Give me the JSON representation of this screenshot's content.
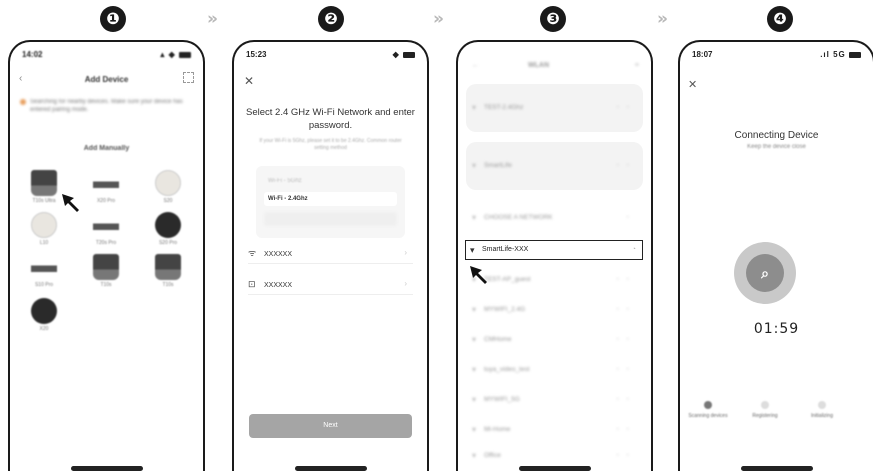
{
  "steps": [
    "❶",
    "❷",
    "❸",
    "❹"
  ],
  "separator": "»",
  "phone1": {
    "time": "14:02",
    "title": "Add Device",
    "notice": "Searching for nearby devices. Make sure your device has entered pairing mode.",
    "section": "Add Manually",
    "devices": [
      {
        "label": "T10s Ultra"
      },
      {
        "label": "X20 Pro"
      },
      {
        "label": "S20"
      },
      {
        "label": "L10"
      },
      {
        "label": "T20s Pro"
      },
      {
        "label": "S20 Pro"
      },
      {
        "label": "S10 Pro"
      },
      {
        "label": "T10s"
      },
      {
        "label": "T10s"
      },
      {
        "label": "X20"
      }
    ]
  },
  "phone2": {
    "time": "15:23",
    "title": "Select 2.4 GHz Wi-Fi Network and enter password.",
    "hint": "If your Wi-Fi is 5Ghz, please set it to be 2.4Ghz. Common router setting method",
    "wifi_rows": [
      "Wi-Fi - 5Ghz",
      "Wi-Fi - 2.4Ghz"
    ],
    "ssid": "XXXXXX",
    "password": "XXXXXX",
    "next_label": "Next"
  },
  "phone3": {
    "title": "WLAN",
    "networks_top": [
      "TEST-2.4Ghz",
      "SmartLife"
    ],
    "other_label": "CHOOSE A NETWORK",
    "selected_network": "SmartLife-XXX",
    "networks": [
      "TEST-AP_guest",
      "MYWIFI_2.4G",
      "CMHome",
      "tuya_video_test",
      "MYWIFI_5G",
      "Mi-Home",
      "Office"
    ]
  },
  "phone4": {
    "time": "18:07",
    "title": "Connecting Device",
    "subtitle": "Keep the device close",
    "timer": "01:59",
    "stages": [
      "Scanning devices",
      "Registering",
      "Initializing"
    ]
  }
}
